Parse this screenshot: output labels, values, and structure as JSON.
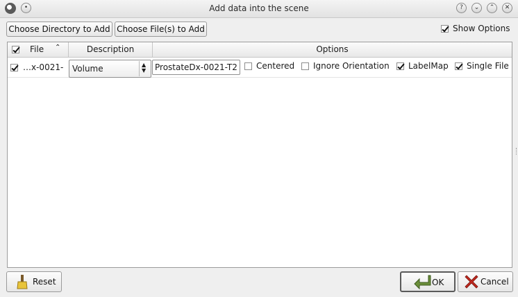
{
  "window": {
    "title": "Add data into the scene",
    "buttons": {
      "help": "?",
      "minimize": "⌄",
      "maximize": "⌃",
      "close": "✕"
    }
  },
  "toolbar": {
    "choose_directory": "Choose Directory to Add",
    "choose_files": "Choose File(s) to Add",
    "show_options": "Show Options",
    "show_options_checked": true
  },
  "table": {
    "columns": {
      "file": "File",
      "description": "Description",
      "options": "Options"
    },
    "header_checked": true,
    "rows": [
      {
        "checked": true,
        "file": "…x-0021-",
        "description": "Volume",
        "name": "ProstateDx-0021-T2",
        "centered": {
          "label": "Centered",
          "checked": false
        },
        "ignore_orientation": {
          "label": "Ignore Orientation",
          "checked": false
        },
        "labelmap": {
          "label": "LabelMap",
          "checked": true
        },
        "single_file": {
          "label": "Single File",
          "checked": true
        }
      }
    ]
  },
  "footer": {
    "reset": "Reset",
    "ok": "OK",
    "cancel": "Cancel"
  },
  "colors": {
    "background": "#efefef",
    "table_bg": "#ffffff",
    "border": "#9c9c9c"
  }
}
